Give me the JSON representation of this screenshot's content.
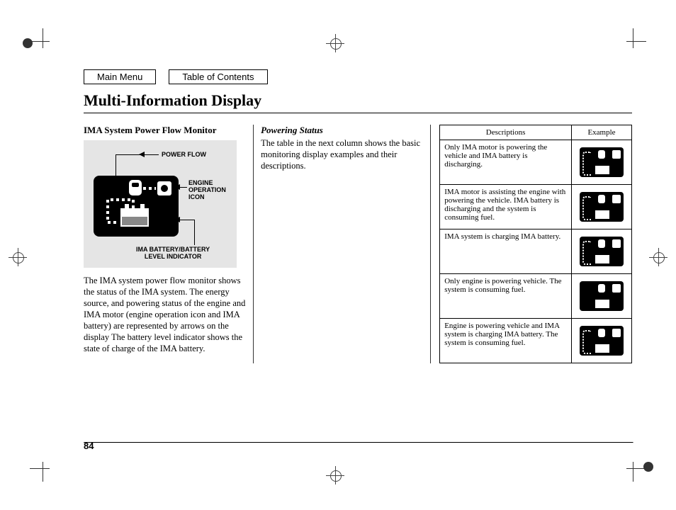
{
  "nav": {
    "main_menu": "Main Menu",
    "toc": "Table of Contents"
  },
  "title": "Multi-Information Display",
  "section": {
    "heading": "IMA System Power Flow Monitor",
    "labels": {
      "power_flow": "POWER FLOW",
      "engine_icon": "ENGINE\nOPERATION\nICON",
      "battery_indicator": "IMA BATTERY/BATTERY\nLEVEL INDICATOR"
    },
    "body": "The IMA system power flow monitor shows the status of the IMA system. The energy source, and powering status of the engine and IMA motor (engine operation icon and IMA battery) are represented by arrows on the display The battery level indicator shows the state of charge of the IMA battery."
  },
  "col2": {
    "heading": "Powering Status",
    "body": "The table in the next column shows the basic monitoring display examples and their descriptions."
  },
  "table": {
    "head_desc": "Descriptions",
    "head_ex": "Example",
    "rows": [
      {
        "desc": "Only IMA motor is powering the vehicle and IMA battery is discharging."
      },
      {
        "desc": "IMA motor is assisting the engine with powering the vehicle. IMA battery is discharging and the system is consuming fuel."
      },
      {
        "desc": "IMA system is charging IMA battery."
      },
      {
        "desc": "Only engine is powering vehicle. The system is consuming fuel."
      },
      {
        "desc": "Engine is powering vehicle and IMA system is charging IMA battery. The system is consuming fuel."
      }
    ]
  },
  "page_number": "84"
}
